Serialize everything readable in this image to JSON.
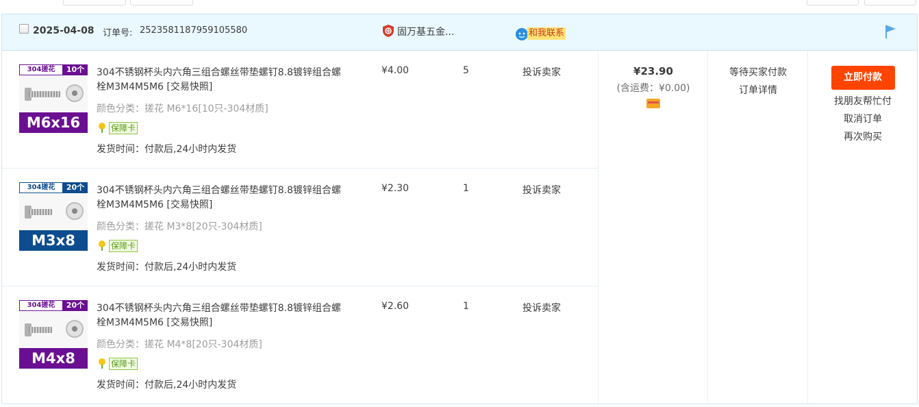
{
  "order": {
    "date": "2025-04-08",
    "order_no_label": "订单号:",
    "order_no": "2523581187959105580",
    "shop_name": "固万基五金...",
    "contact_label": "和我联系",
    "total": "¥23.90",
    "shipping": "(含运费：¥0.00)",
    "status": "等待买家付款",
    "detail_link": "订单详情",
    "pay_button": "立即付款",
    "ops": [
      "找朋友帮忙付",
      "取消订单",
      "再次购买"
    ],
    "items": [
      {
        "title": "304不锈钢杯头内六角三组合螺丝带垫螺钉8.8镀锌组合螺栓M3M4M5M6 [交易快照]",
        "sku": "颜色分类：搓花 M6*16[10只-304材质]",
        "card": "保障卡",
        "ship": "发货时间：付款后,24小时内发货",
        "price": "¥4.00",
        "qty": "5",
        "complain": "投诉卖家",
        "thumb_tag1": "304搓花",
        "thumb_tag2": "10个",
        "thumb_size": "M6x16",
        "thumb_color": "#6a0f92"
      },
      {
        "title": "304不锈钢杯头内六角三组合螺丝带垫螺钉8.8镀锌组合螺栓M3M4M5M6 [交易快照]",
        "sku": "颜色分类：搓花 M3*8[20只-304材质]",
        "card": "保障卡",
        "ship": "发货时间：付款后,24小时内发货",
        "price": "¥2.30",
        "qty": "1",
        "complain": "投诉卖家",
        "thumb_tag1": "304搓花",
        "thumb_tag2": "20个",
        "thumb_size": "M3x8",
        "thumb_color": "#0d4c8e"
      },
      {
        "title": "304不锈钢杯头内六角三组合螺丝带垫螺钉8.8镀锌组合螺栓M3M4M5M6 [交易快照]",
        "sku": "颜色分类：搓花 M4*8[20只-304材质]",
        "card": "保障卡",
        "ship": "发货时间：付款后,24小时内发货",
        "price": "¥2.60",
        "qty": "1",
        "complain": "投诉卖家",
        "thumb_tag1": "304搓花",
        "thumb_tag2": "20个",
        "thumb_size": "M4x8",
        "thumb_color": "#6a0f92"
      }
    ]
  },
  "colors": {
    "header_bg": "#eaf8ff",
    "border": "#cde4f3",
    "pay_button": "#ff4400",
    "contact_bg": "#ffe473"
  }
}
